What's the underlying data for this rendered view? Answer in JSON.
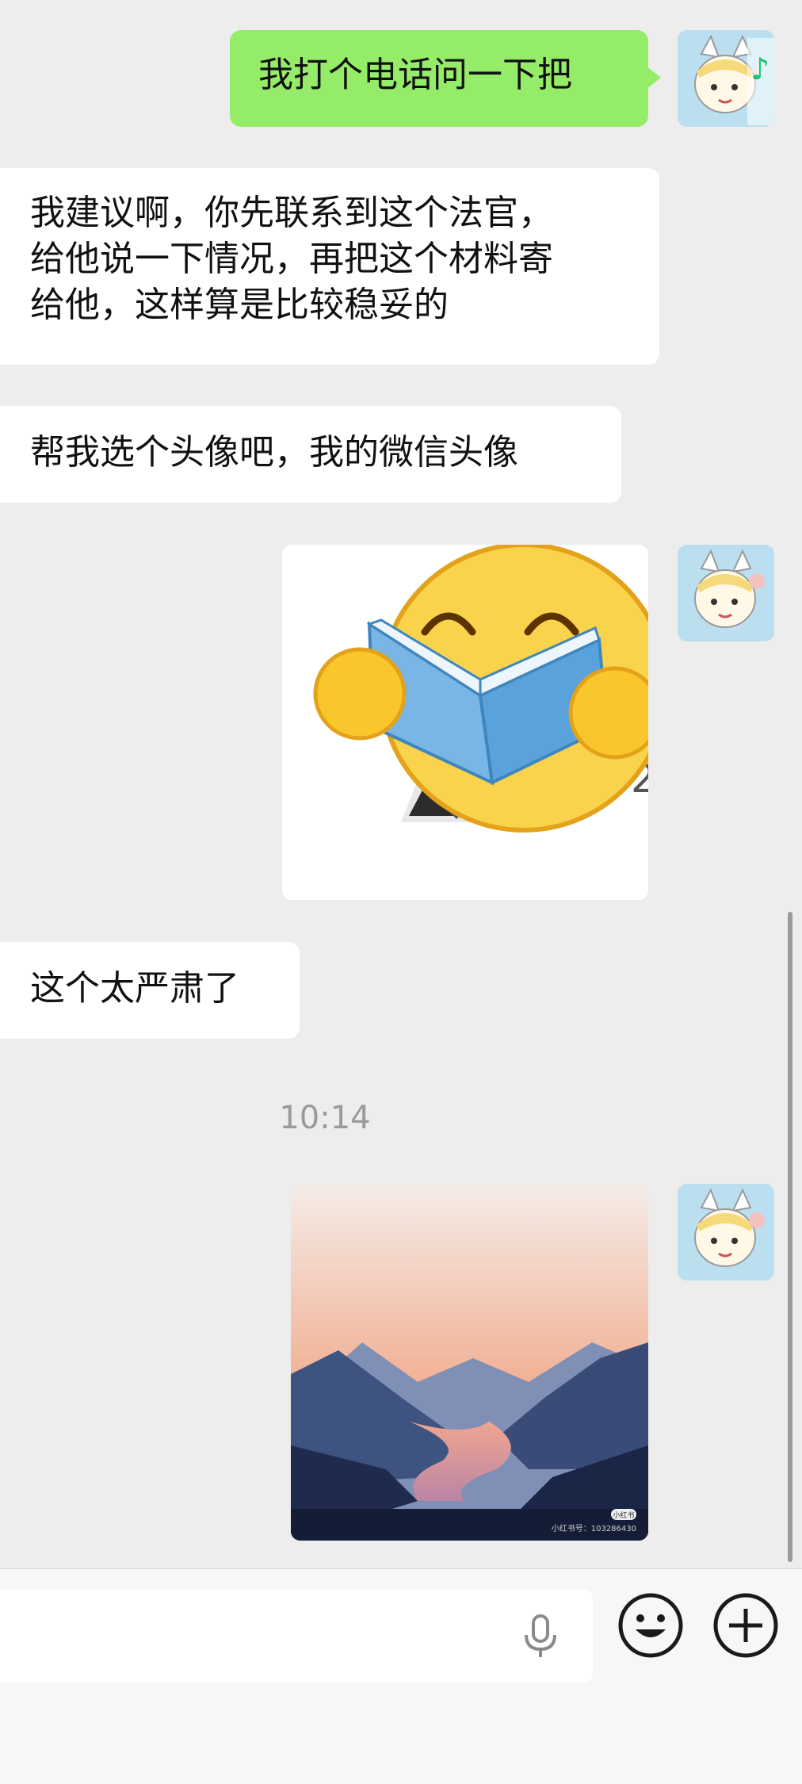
{
  "messages": [
    {
      "side": "out",
      "type": "text",
      "text": "我打个电话问一下把"
    },
    {
      "side": "in",
      "type": "text",
      "lines": [
        "我建议啊，你先联系到这个法官，",
        "给他说一下情况，再把这个材料寄",
        "给他，这样算是比较稳妥的"
      ]
    },
    {
      "side": "in",
      "type": "text",
      "text": "帮我选个头像吧，我的微信头像"
    },
    {
      "side": "out",
      "type": "image",
      "description_icon": "reading-emoji-sticker",
      "partial_text": "2"
    },
    {
      "side": "in",
      "type": "text",
      "text": "这个太严肃了"
    },
    {
      "side": "out",
      "type": "image",
      "description_icon": "mountain-sunset-image",
      "watermark_badge": "小红书",
      "watermark_text": "小红书号：103286430"
    }
  ],
  "timestamp": "10:14",
  "input_bar": {
    "icons": [
      "microphone-icon",
      "emoji-icon",
      "plus-icon"
    ]
  },
  "colors": {
    "background": "#ededed",
    "out_bubble": "#95ec69",
    "in_bubble": "#ffffff",
    "timestamp": "#9a9a9a"
  }
}
